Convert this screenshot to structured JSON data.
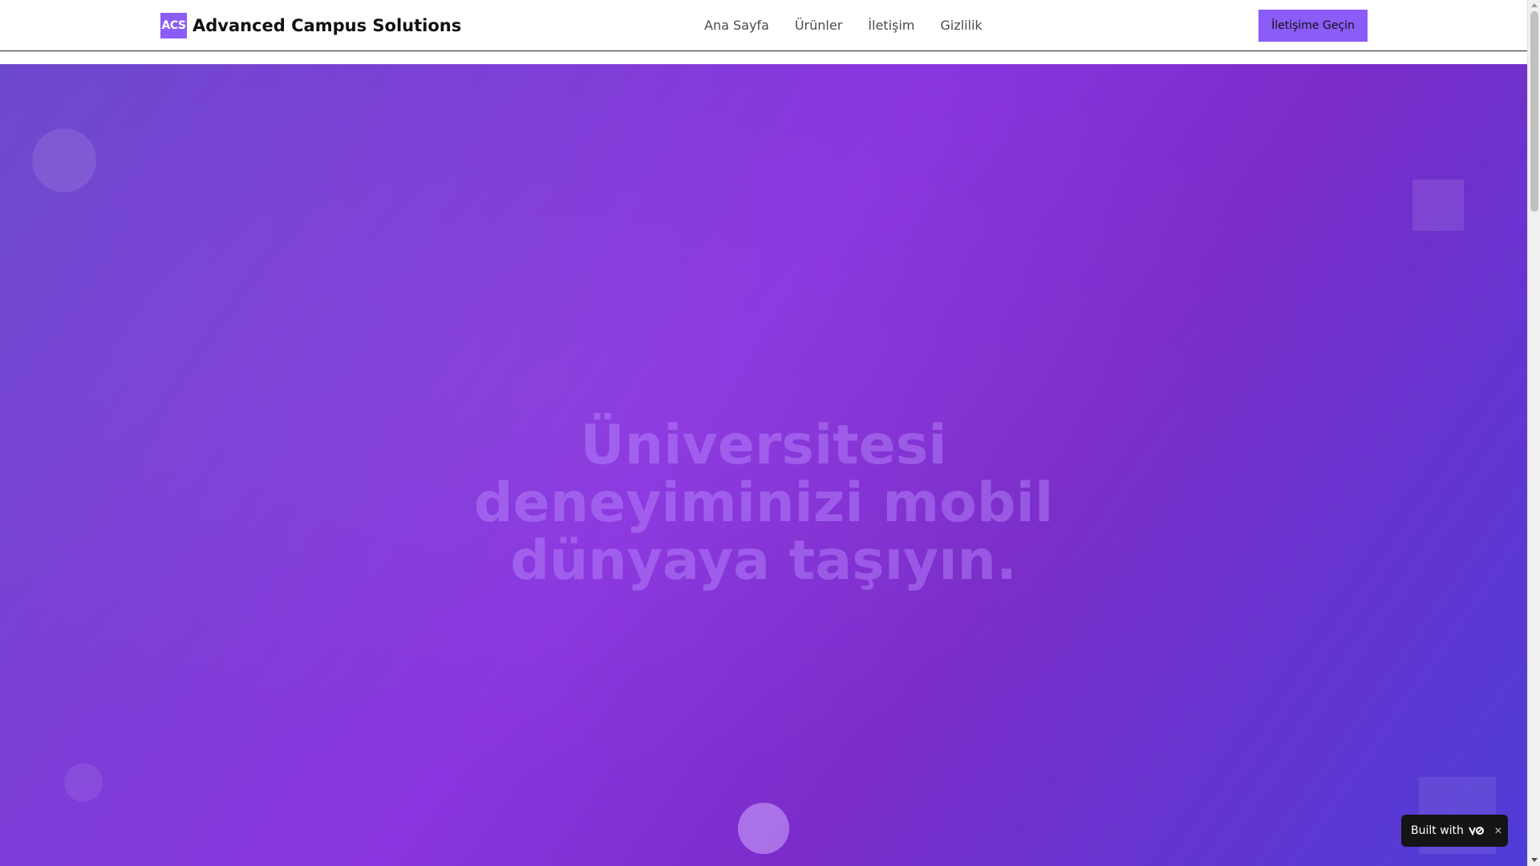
{
  "header": {
    "logo_badge": "ACS",
    "brand_name": "Advanced Campus Solutions",
    "nav": [
      {
        "label": "Ana Sayfa"
      },
      {
        "label": "Ürünler"
      },
      {
        "label": "İletişim"
      },
      {
        "label": "Gizlilik"
      }
    ],
    "cta_label": "İletişime Geçin"
  },
  "hero": {
    "title": "Üniversitesi deneyiminizi mobil dünyaya taşıyın."
  },
  "badge": {
    "label": "Built with",
    "logo_icon": "v0-logo-icon",
    "close_icon": "close-icon"
  },
  "colors": {
    "accent": "#8b5cf6",
    "hero_start": "#6d49cd",
    "hero_mid": "#8a35df",
    "hero_end": "#4f3dd6"
  }
}
